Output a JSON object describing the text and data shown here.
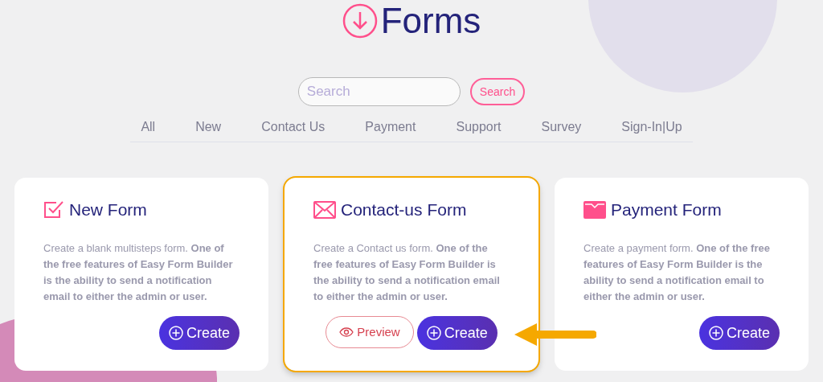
{
  "header": {
    "title": "Forms"
  },
  "search": {
    "placeholder": "Search",
    "button": "Search"
  },
  "tabs": [
    "All",
    "New",
    "Contact Us",
    "Payment",
    "Support",
    "Survey",
    "Sign-In|Up"
  ],
  "cards": [
    {
      "kind": "new",
      "title": "New Form",
      "description": "Create a blank multisteps form. **One of the free features of Easy Form Builder is the ability to send a notification email to either the admin or user.**",
      "highlighted": false,
      "buttons": [
        {
          "kind": "create",
          "label": "Create"
        }
      ]
    },
    {
      "kind": "contact",
      "title": "Contact-us Form",
      "description": "Create a Contact us form. **One of the free features of Easy Form Builder is the ability to send a notification email to either the admin or user.**",
      "highlighted": true,
      "buttons": [
        {
          "kind": "preview",
          "label": "Preview"
        },
        {
          "kind": "create",
          "label": "Create"
        }
      ]
    },
    {
      "kind": "payment",
      "title": "Payment Form",
      "description": "Create a payment form. **One of the free features of Easy Form Builder is the ability to send a notification email to either the admin or user.**",
      "highlighted": false,
      "buttons": [
        {
          "kind": "create",
          "label": "Create"
        }
      ]
    }
  ]
}
